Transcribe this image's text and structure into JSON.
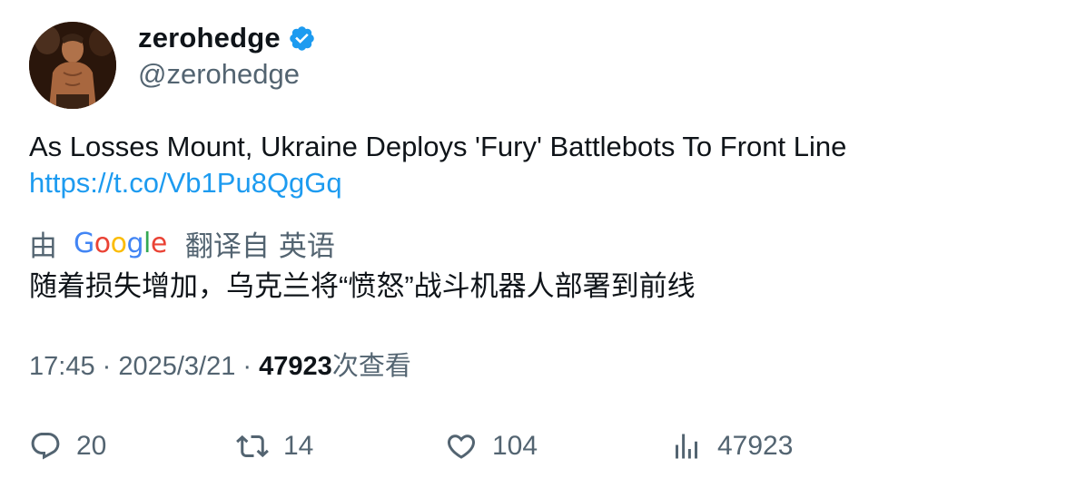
{
  "author": {
    "display_name": "zerohedge",
    "handle": "@zerohedge",
    "verified": true,
    "verified_color": "#1d9bf0"
  },
  "tweet": {
    "text": "As Losses Mount, Ukraine Deploys 'Fury' Battlebots To Front Line",
    "link": "https://t.co/Vb1Pu8QgGq",
    "link_color": "#1d9bf0"
  },
  "translation": {
    "prefix": "由",
    "provider": "Google",
    "translated_from": "翻译自",
    "source_language": "英语",
    "text": "随着损失增加，乌克兰将“愤怒”战斗机器人部署到前线",
    "provider_letters": [
      {
        "char": "G",
        "color": "#4285F4"
      },
      {
        "char": "o",
        "color": "#EA4335"
      },
      {
        "char": "o",
        "color": "#FBBC05"
      },
      {
        "char": "g",
        "color": "#4285F4"
      },
      {
        "char": "l",
        "color": "#34A853"
      },
      {
        "char": "e",
        "color": "#EA4335"
      }
    ]
  },
  "meta": {
    "time": "17:45",
    "separator": " · ",
    "date": "2025/3/21",
    "views_count": "47923",
    "views_label": "次查看"
  },
  "actions": {
    "replies": "20",
    "retweets": "14",
    "likes": "104",
    "views": "47923",
    "icons": [
      "reply-icon",
      "retweet-icon",
      "like-icon",
      "views-icon"
    ]
  }
}
